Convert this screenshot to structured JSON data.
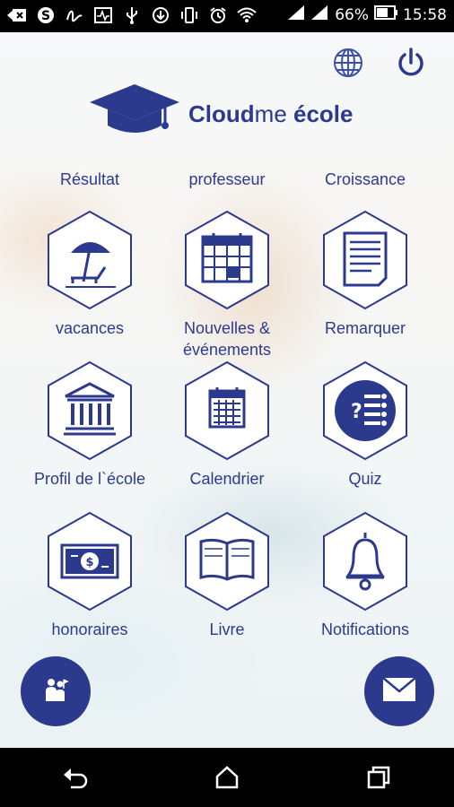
{
  "status_bar": {
    "battery_percent": "66%",
    "time": "15:58",
    "left_icons": [
      "back-arrow-icon",
      "skype-icon",
      "scribble-icon",
      "activity-icon",
      "usb-icon",
      "download-icon",
      "vibrate-icon",
      "alarm-icon",
      "wifi-icon"
    ],
    "right_icons": [
      "signal-icon",
      "signal-icon",
      "battery-icon"
    ]
  },
  "header": {
    "brand_bold": "Cloud",
    "brand_light": "me",
    "brand_suffix": " école",
    "icons": [
      "globe-icon",
      "power-icon"
    ]
  },
  "partial_row": [
    "Résultat",
    "professeur",
    "Croissance"
  ],
  "tiles": [
    {
      "label": "vacances",
      "icon": "beach-umbrella-icon"
    },
    {
      "label": "Nouvelles & événements",
      "icon": "calendar-event-icon"
    },
    {
      "label": "Remarquer",
      "icon": "document-icon"
    },
    {
      "label": "Profil de l`école",
      "icon": "institution-icon"
    },
    {
      "label": "Calendrier",
      "icon": "calendar-icon"
    },
    {
      "label": "Quiz",
      "icon": "quiz-icon"
    },
    {
      "label": "honoraires",
      "icon": "banknote-icon"
    },
    {
      "label": "Livre",
      "icon": "book-icon"
    },
    {
      "label": "Notifications",
      "icon": "bell-icon"
    }
  ],
  "fabs": {
    "left_icon": "students-icon",
    "right_icon": "mail-icon"
  },
  "nav_bar": [
    "back-icon",
    "home-icon",
    "recents-icon"
  ],
  "colors": {
    "accent": "#2c3a8e",
    "tile_bg": "#ffffff",
    "statusbar": "#000000"
  }
}
